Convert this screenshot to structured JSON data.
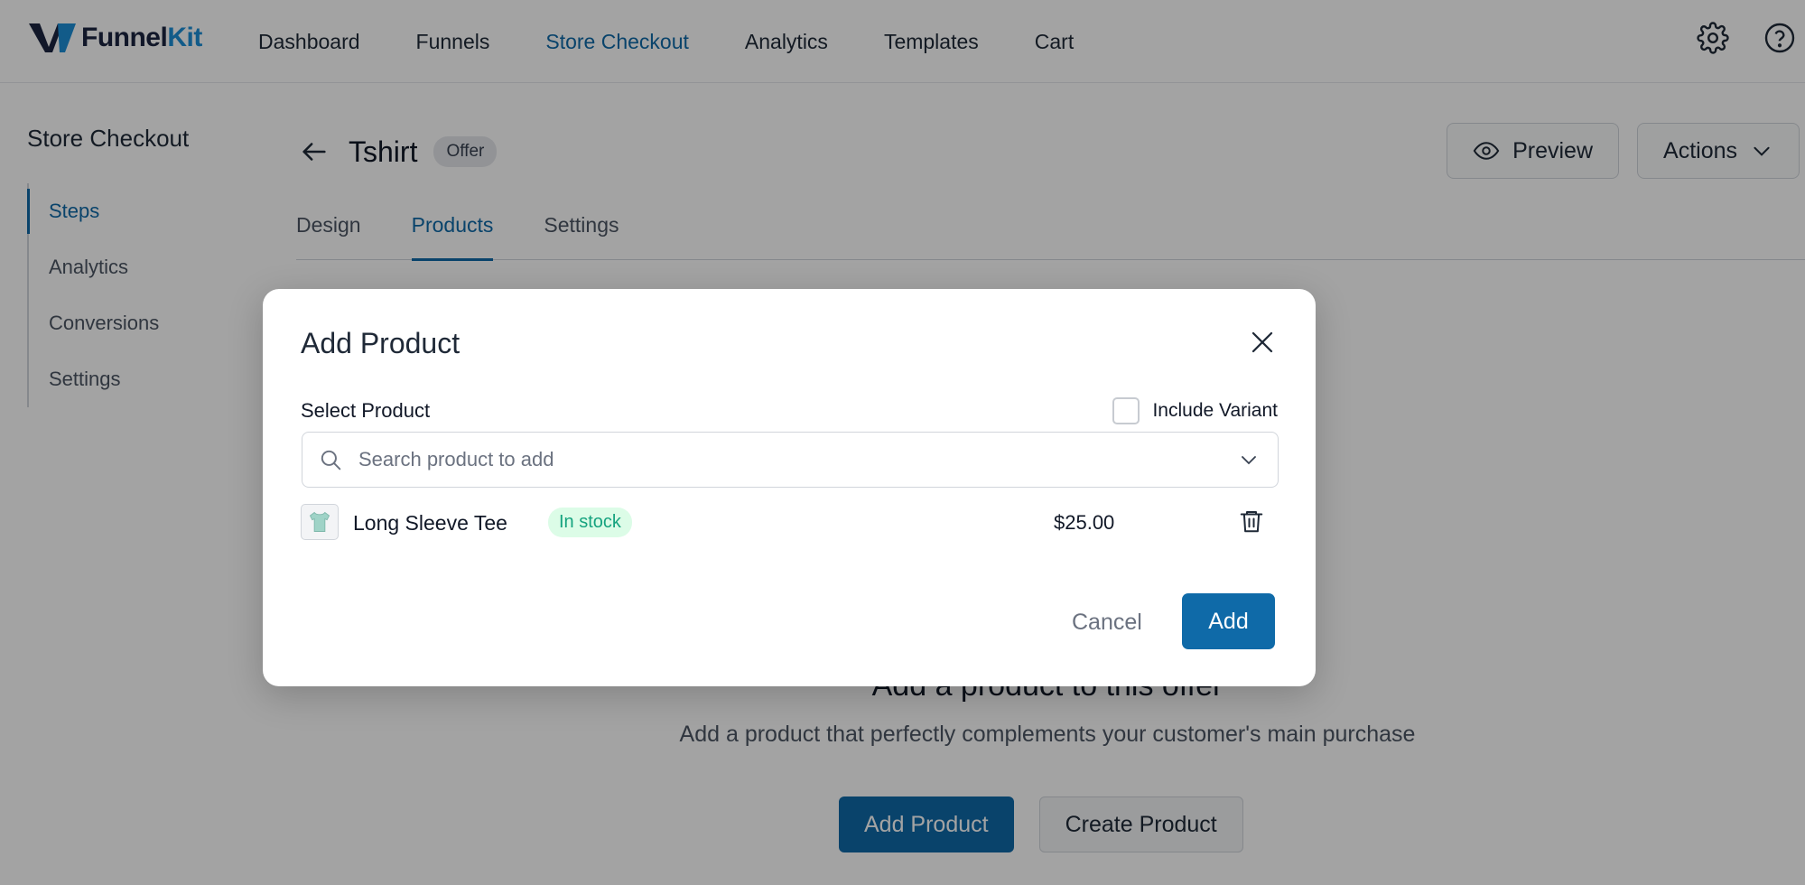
{
  "brand": {
    "name_main": "Funnel",
    "name_accent": "Kit",
    "logo_color": "#1c2541",
    "accent_color": "#1d8fd6"
  },
  "nav": {
    "items": [
      {
        "label": "Dashboard"
      },
      {
        "label": "Funnels"
      },
      {
        "label": "Store Checkout",
        "active": true
      },
      {
        "label": "Analytics"
      },
      {
        "label": "Templates"
      },
      {
        "label": "Cart"
      }
    ],
    "icons": [
      "gear-icon",
      "help-icon"
    ]
  },
  "sidebar": {
    "title": "Store Checkout",
    "items": [
      {
        "label": "Steps",
        "active": true
      },
      {
        "label": "Analytics"
      },
      {
        "label": "Conversions"
      },
      {
        "label": "Settings"
      }
    ]
  },
  "page": {
    "title": "Tshirt",
    "badge": "Offer",
    "preview_label": "Preview",
    "actions_label": "Actions",
    "tabs": [
      {
        "label": "Design"
      },
      {
        "label": "Products",
        "active": true
      },
      {
        "label": "Settings"
      }
    ]
  },
  "empty_state": {
    "title": "Add a product to this offer",
    "subtitle": "Add a product that perfectly complements your customer's main purchase",
    "add_button": "Add Product",
    "create_button": "Create Product"
  },
  "modal": {
    "title": "Add Product",
    "select_label": "Select Product",
    "include_variant_label": "Include Variant",
    "include_variant_checked": false,
    "search_placeholder": "Search product to add",
    "products": [
      {
        "name": "Long Sleeve Tee",
        "stock": "In stock",
        "price": "$25.00"
      }
    ],
    "cancel_label": "Cancel",
    "add_label": "Add"
  },
  "colors": {
    "primary": "#0f6aa8",
    "success": "#16a37f",
    "success_bg": "#dcfce7"
  }
}
